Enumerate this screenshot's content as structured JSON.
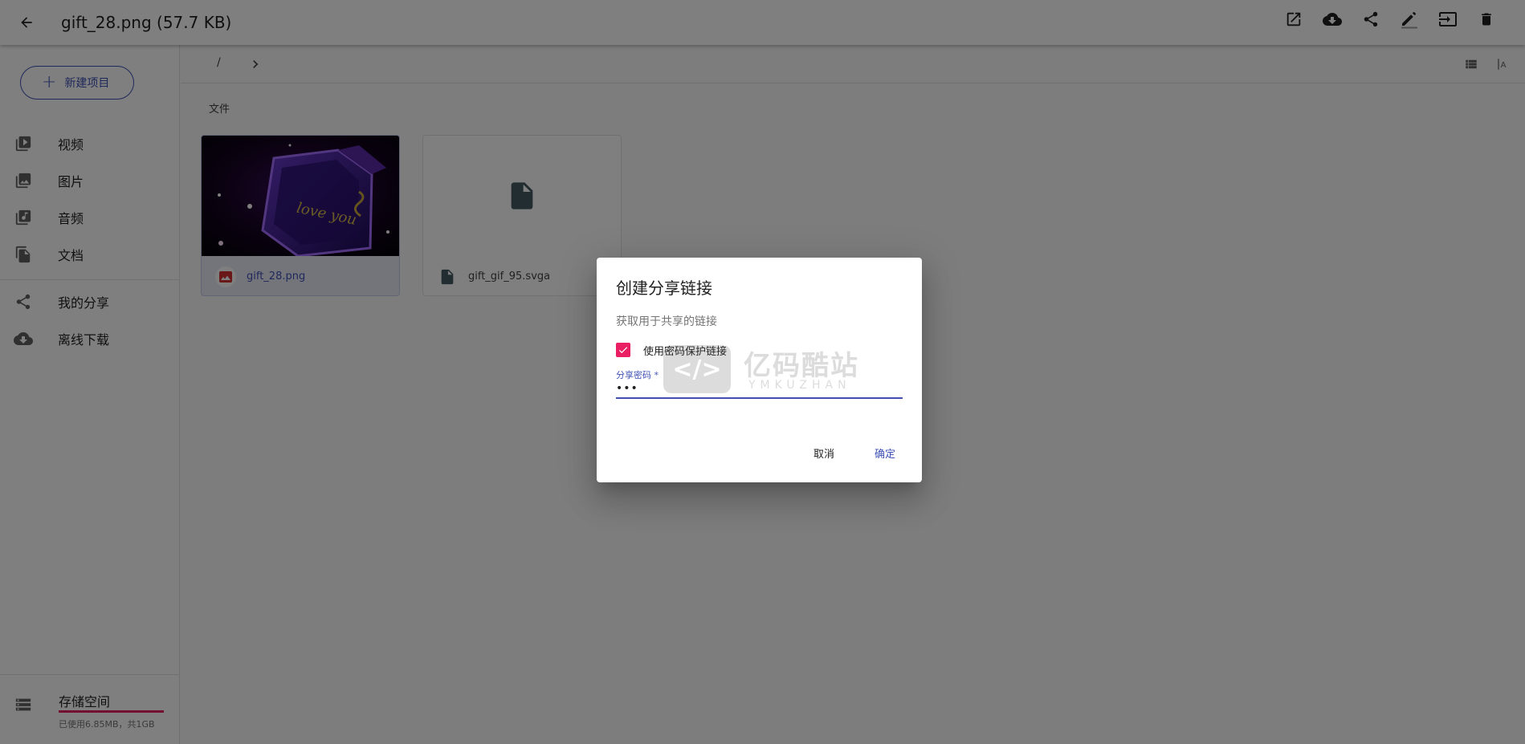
{
  "appbar": {
    "title": "gift_28.png (57.7 KB)",
    "icons": [
      "arrow-back-icon",
      "open-in-new-icon",
      "cloud-download-icon",
      "share-icon",
      "rename-icon",
      "move-icon",
      "delete-icon"
    ]
  },
  "sidebar": {
    "new_button": "新建项目",
    "items": [
      {
        "label": "视频",
        "icon": "video-library-icon"
      },
      {
        "label": "图片",
        "icon": "photo-library-icon"
      },
      {
        "label": "音频",
        "icon": "library-music-icon"
      },
      {
        "label": "文档",
        "icon": "file-copy-icon"
      }
    ],
    "items2": [
      {
        "label": "我的分享",
        "icon": "share-icon"
      },
      {
        "label": "离线下载",
        "icon": "cloud-download-icon"
      }
    ],
    "storage": {
      "label": "存储空间",
      "usage": "已使用6.85MB，共1GB",
      "fill_fraction": 1.0
    }
  },
  "toolbar": {
    "breadcrumb_root": "/"
  },
  "content": {
    "section_label": "文件",
    "files": [
      {
        "name": "gift_28.png",
        "type": "image",
        "selected": true
      },
      {
        "name": "gift_gif_95.svga",
        "type": "document",
        "selected": false
      }
    ],
    "thumbnail_text": "love you"
  },
  "dialog": {
    "title": "创建分享链接",
    "description": "获取用于共享的链接",
    "checkbox_label": "使用密码保护链接",
    "checkbox_checked": true,
    "field_label": "分享密码 *",
    "field_value": "•••",
    "cancel": "取消",
    "confirm": "确定"
  },
  "watermark": {
    "cn": "亿码酷站",
    "en": "YMKUZHAN",
    "symbol": "</>"
  },
  "colors": {
    "primary": "#3f51b5",
    "accent": "#e91e63"
  }
}
